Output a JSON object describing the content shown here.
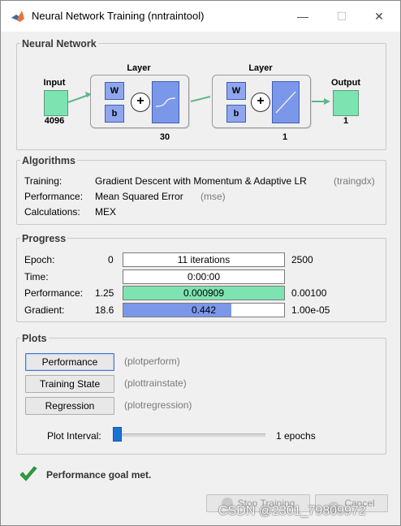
{
  "window": {
    "title": "Neural Network Training (nntraintool)",
    "controls": {
      "minimize": "—",
      "maximize": "☐",
      "close": "✕"
    }
  },
  "network": {
    "section_title": "Neural Network",
    "input_label": "Input",
    "input_size": "4096",
    "hidden_layer_label": "Layer",
    "hidden_size": "30",
    "output_layer_label": "Layer",
    "output_layer_size": "1",
    "output_label": "Output",
    "output_size": "1",
    "weight_symbol": "W",
    "bias_symbol": "b",
    "sum_symbol": "+"
  },
  "algorithms": {
    "section_title": "Algorithms",
    "rows": [
      {
        "label": "Training:",
        "value": "Gradient Descent with Momentum & Adaptive LR",
        "code": "(traingdx)"
      },
      {
        "label": "Performance:",
        "value": "Mean Squared Error",
        "code": "(mse)"
      },
      {
        "label": "Calculations:",
        "value": "MEX",
        "code": ""
      }
    ]
  },
  "progress": {
    "section_title": "Progress",
    "rows": [
      {
        "label": "Epoch:",
        "min": "0",
        "text": "11 iterations",
        "max": "2500",
        "fill": 0,
        "color": "#ffffff"
      },
      {
        "label": "Time:",
        "min": "",
        "text": "0:00:00",
        "max": "",
        "fill": 0,
        "color": "#ffffff"
      },
      {
        "label": "Performance:",
        "min": "1.25",
        "text": "0.000909",
        "max": "0.00100",
        "fill": 1.0,
        "color": "#7de3b0"
      },
      {
        "label": "Gradient:",
        "min": "18.6",
        "text": "0.442",
        "max": "1.00e-05",
        "fill": 0.67,
        "color": "#7b97ea"
      }
    ]
  },
  "plots": {
    "section_title": "Plots",
    "buttons": [
      {
        "label": "Performance",
        "code": "(plotperform)"
      },
      {
        "label": "Training State",
        "code": "(plottrainstate)"
      },
      {
        "label": "Regression",
        "code": "(plotregression)"
      }
    ],
    "interval_label": "Plot Interval:",
    "interval_value_text": "1 epochs",
    "interval_fraction": 0.0
  },
  "status": {
    "message": "Performance goal met.",
    "check_color": "#2ea043"
  },
  "footer": {
    "stop_label": "Stop Training",
    "cancel_label": "Cancel"
  },
  "watermark": "CSDN @2301_79809972",
  "colors": {
    "accent_green": "#7de3b0",
    "accent_blue": "#7b97ea",
    "slider_thumb": "#1a72d6"
  }
}
